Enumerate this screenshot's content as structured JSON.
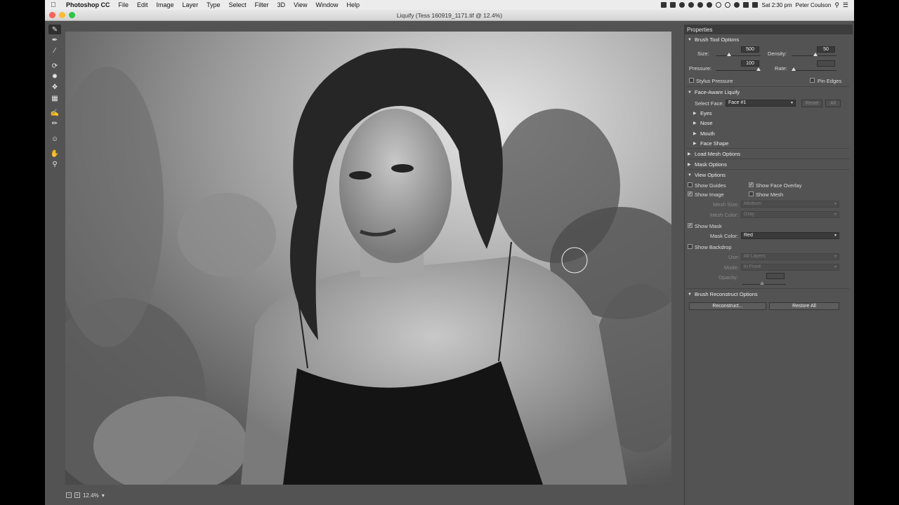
{
  "menubar": {
    "app": "Photoshop CC",
    "menus": [
      "File",
      "Edit",
      "Image",
      "Layer",
      "Type",
      "Select",
      "Filter",
      "3D",
      "View",
      "Window",
      "Help"
    ],
    "clock": "Sat 2:30 pm",
    "user": "Peter Coulson"
  },
  "window": {
    "title": "Liquify (Tess 160919_1171.tif @ 12.4%)"
  },
  "statusbar": {
    "zoom": "12.4%"
  },
  "panel": {
    "title": "Properties",
    "brush": {
      "section": "Brush Tool Options",
      "size_label": "Size:",
      "size_value": "500",
      "density_label": "Density:",
      "density_value": "50",
      "pressure_label": "Pressure:",
      "pressure_value": "100",
      "rate_label": "Rate:",
      "stylus_label": "Stylus Pressure",
      "pin_edges_label": "Pin Edges"
    },
    "face": {
      "section": "Face-Aware Liquify",
      "select_label": "Select Face:",
      "select_value": "Face #1",
      "reset_label": "Reset",
      "all_label": "All",
      "eyes": "Eyes",
      "nose": "Nose",
      "mouth": "Mouth",
      "face_shape": "Face Shape"
    },
    "load_mesh": "Load Mesh Options",
    "mask_options": "Mask Options",
    "view": {
      "section": "View Options",
      "show_guides": "Show Guides",
      "show_face_overlay": "Show Face Overlay",
      "show_image": "Show Image",
      "show_mesh": "Show Mesh",
      "mesh_size_label": "Mesh Size:",
      "mesh_size_value": "Medium",
      "mesh_color_label": "Mesh Color:",
      "mesh_color_value": "Gray",
      "show_mask": "Show Mask",
      "mask_color_label": "Mask Color:",
      "mask_color_value": "Red",
      "show_backdrop": "Show Backdrop",
      "use_label": "Use:",
      "use_value": "All Layers",
      "mode_label": "Mode:",
      "mode_value": "In Front",
      "opacity_label": "Opacity:"
    },
    "reconstruct": {
      "section": "Brush Reconstruct Options",
      "reconstruct_btn": "Reconstruct...",
      "restore_btn": "Restore All"
    }
  }
}
